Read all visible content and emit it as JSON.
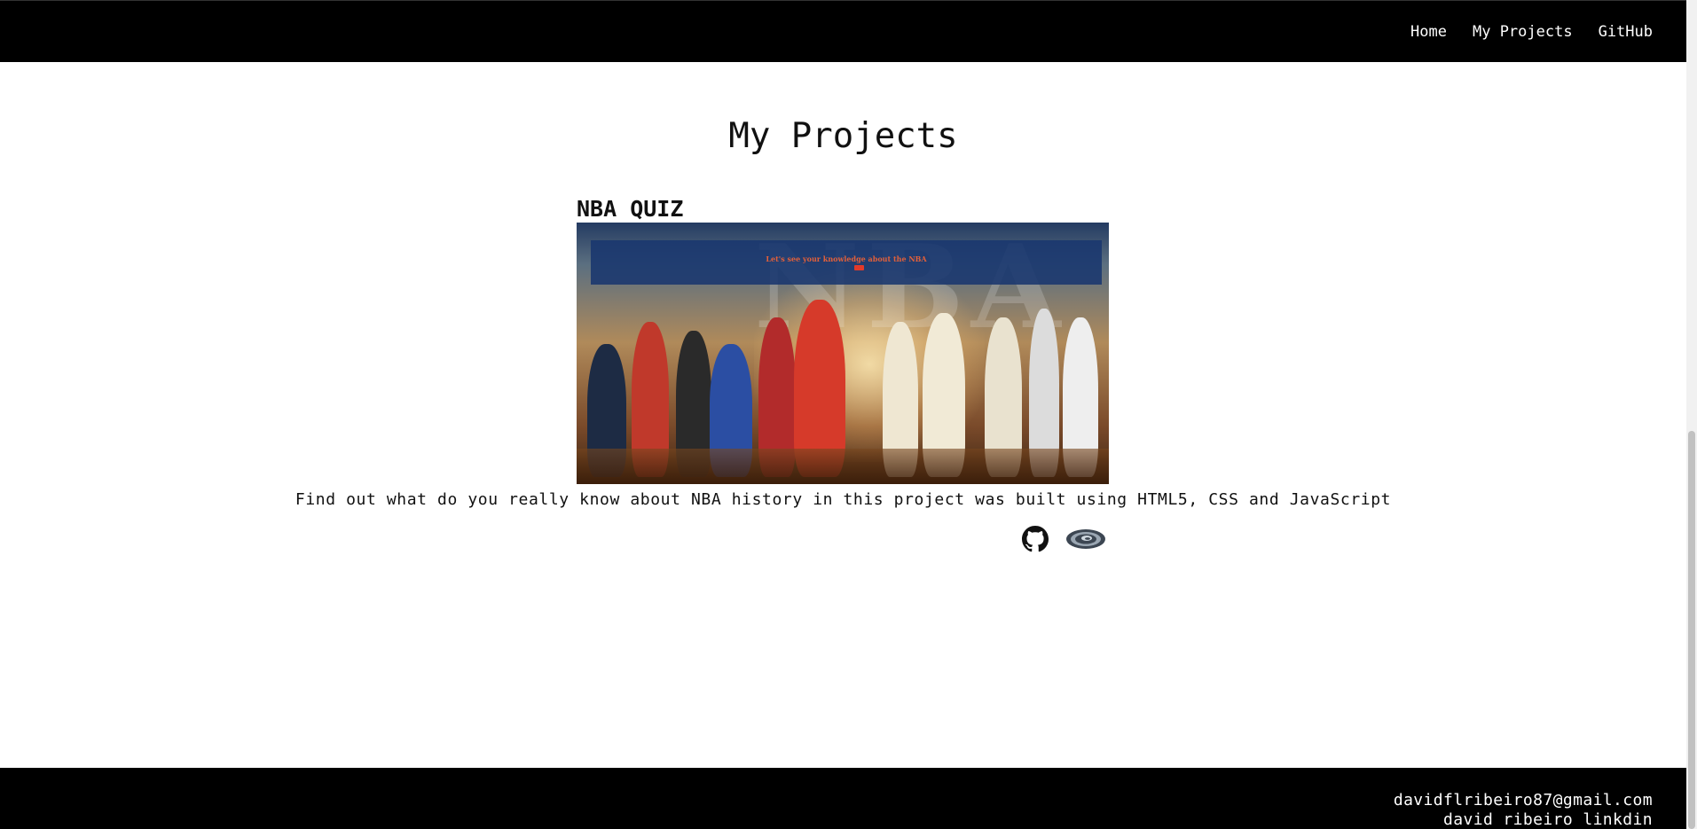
{
  "nav": {
    "items": [
      {
        "label": "Home"
      },
      {
        "label": "My Projects"
      },
      {
        "label": "GitHub"
      }
    ]
  },
  "main": {
    "title": "My Projects",
    "projects": [
      {
        "title": "NBA QUIZ",
        "image": {
          "banner_text": "Let's see your knowledge about the NBA",
          "wordmark": "NBA"
        },
        "description": "Find out what do you really know about NBA history in this project was built using HTML5, CSS and JavaScript",
        "links": [
          {
            "icon": "github-icon"
          },
          {
            "icon": "live-site-icon"
          }
        ]
      }
    ]
  },
  "footer": {
    "email": "davidflribeiro87@gmail.com",
    "linkedin": "david ribeiro linkdin"
  },
  "colors": {
    "header_bg": "#000000",
    "footer_bg": "#000000",
    "page_bg": "#ffffff",
    "banner_bg": "#19376e",
    "banner_text": "#e2603a"
  }
}
